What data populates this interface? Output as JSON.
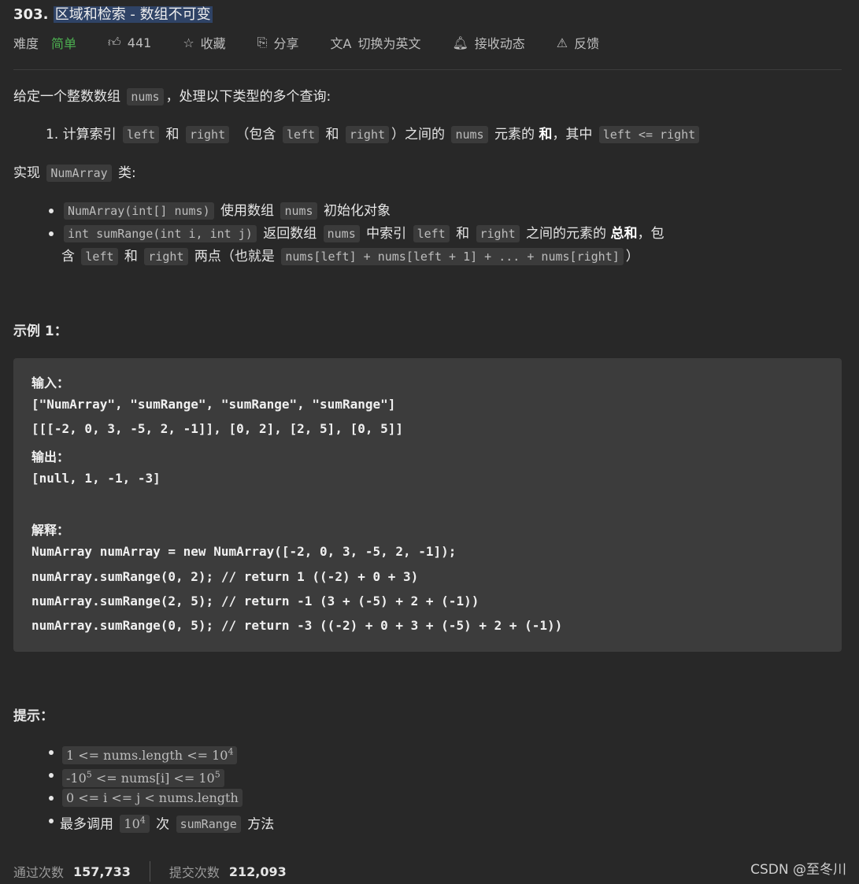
{
  "title": {
    "number": "303.",
    "name": "区域和检索 - 数组不可变"
  },
  "meta": {
    "difficulty_label": "难度",
    "difficulty": "简单",
    "likes": "441",
    "favorite": "收藏",
    "share": "分享",
    "switch_lang": "切换为英文",
    "subscribe": "接收动态",
    "feedback": "反馈",
    "icons": [
      "thumbs-up-icon",
      "star-icon",
      "share-icon",
      "translate-icon",
      "bell-icon",
      "feedback-icon"
    ],
    "difficulty_color": "#4caf50"
  },
  "desc": [
    [
      {
        "t": "给定一个整数数组 "
      },
      {
        "c": "nums"
      },
      {
        "t": "，处理以下类型的多个查询:"
      }
    ],
    [
      {
        "t": "1. 计算索引 "
      },
      {
        "c": "left"
      },
      {
        "t": " 和 "
      },
      {
        "c": "right"
      },
      {
        "t": "  （包含 "
      },
      {
        "c": "left"
      },
      {
        "t": " 和 "
      },
      {
        "c": "right"
      },
      {
        "t": "）之间的 "
      },
      {
        "c": "nums"
      },
      {
        "t": " 元素的 "
      },
      {
        "b": "和"
      },
      {
        "t": "，其中 "
      },
      {
        "c": "left <= right"
      }
    ],
    [
      {
        "t": "实现 "
      },
      {
        "c": "NumArray"
      },
      {
        "t": " 类:"
      }
    ],
    [
      {
        "c": "NumArray(int[] nums)"
      },
      {
        "t": " 使用数组 "
      },
      {
        "c": "nums"
      },
      {
        "t": " 初始化对象"
      }
    ],
    [
      {
        "c": "int sumRange(int i, int j)"
      },
      {
        "t": " 返回数组 "
      },
      {
        "c": "nums"
      },
      {
        "t": " 中索引 "
      },
      {
        "c": "left"
      },
      {
        "t": " 和 "
      },
      {
        "c": "right"
      },
      {
        "t": " 之间的元素的 "
      },
      {
        "b": "总和"
      },
      {
        "t": "，包"
      }
    ],
    [
      {
        "t": "含 "
      },
      {
        "c": "left"
      },
      {
        "t": " 和 "
      },
      {
        "c": "right"
      },
      {
        "t": " 两点（也就是 "
      },
      {
        "c": "nums[left] + nums[left + 1] + ... + nums[right]"
      },
      {
        "t": "）"
      }
    ]
  ],
  "example_heading": "示例 1：",
  "example": [
    "输入：",
    "[\"NumArray\", \"sumRange\", \"sumRange\", \"sumRange\"]",
    "[[[-2, 0, 3, -5, 2, -1]], [0, 2], [2, 5], [0, 5]]",
    "输出：",
    "[null, 1, -1, -3]",
    "",
    "解释：",
    "NumArray numArray = new NumArray([-2, 0, 3, -5, 2, -1]);",
    "numArray.sumRange(0, 2); // return 1 ((-2) + 0 + 3)",
    "numArray.sumRange(2, 5); // return -1 (3 + (-5) + 2 + (-1))",
    "numArray.sumRange(0, 5); // return -3 ((-2) + 0 + 3 + (-5) + 2 + (-1))"
  ],
  "hints_heading": "提示：",
  "hints": [
    [
      {
        "s": "1 <= nums.length <= 10",
        "sup": "4"
      }
    ],
    [
      {
        "s": "-10",
        "sup": "5",
        "s2": "  <= nums[i] <=  10",
        "sup2": "5"
      }
    ],
    [
      {
        "s": "0 <= i <= j < nums.length"
      }
    ],
    [
      {
        "t": "最多调用 "
      },
      {
        "s": "10",
        "sup": "4"
      },
      {
        "t": " 次 "
      },
      {
        "c": "sumRange"
      },
      {
        "t": " 方法"
      }
    ]
  ],
  "stats": {
    "accepted_label": "通过次数",
    "accepted": "157,733",
    "submitted_label": "提交次数",
    "submitted": "212,093"
  },
  "watermark": "CSDN @至冬川"
}
